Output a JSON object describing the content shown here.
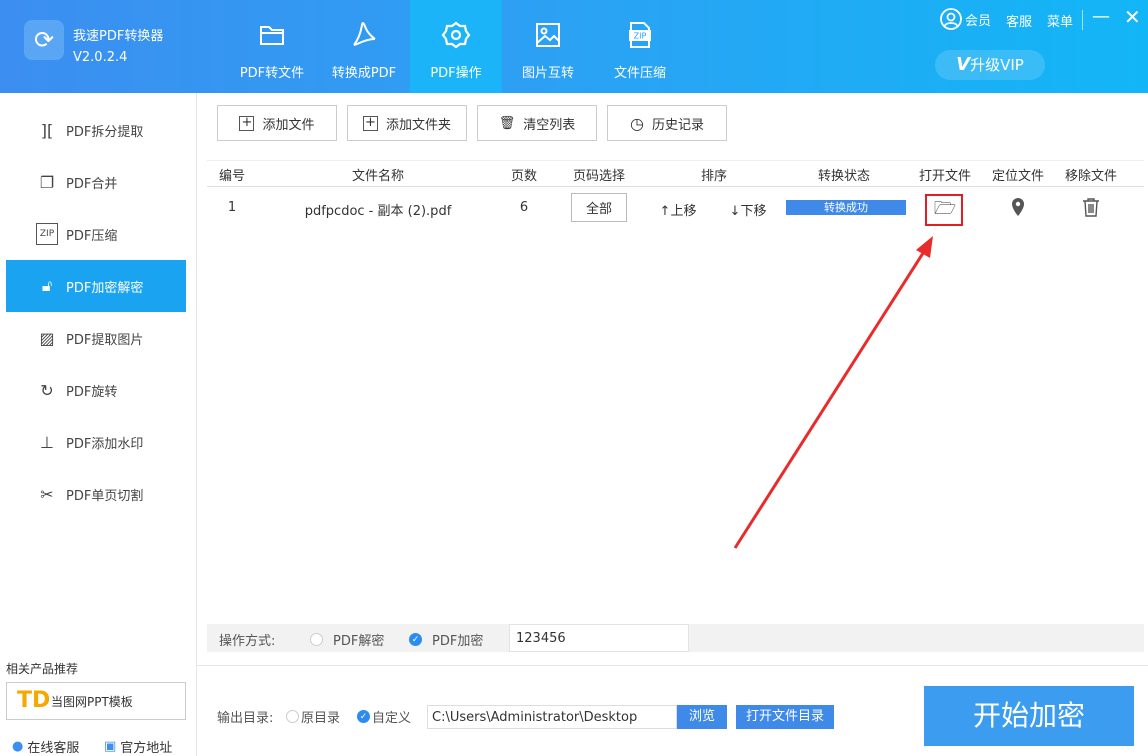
{
  "app": {
    "name": "我速PDF转换器",
    "version": "V2.0.2.4"
  },
  "tabs": [
    {
      "label": "PDF转文件",
      "icon": "folder-icon"
    },
    {
      "label": "转换成PDF",
      "icon": "acrobat-icon"
    },
    {
      "label": "PDF操作",
      "icon": "gear-icon",
      "active": true
    },
    {
      "label": "图片互转",
      "icon": "image-icon"
    },
    {
      "label": "文件压缩",
      "icon": "zip-icon"
    }
  ],
  "topright": {
    "member": "会员",
    "service": "客服",
    "menu": "菜单",
    "vip": "升级VIP"
  },
  "sidebar": {
    "items": [
      {
        "label": "PDF拆分提取",
        "icon": "split-icon"
      },
      {
        "label": "PDF合并",
        "icon": "merge-icon"
      },
      {
        "label": "PDF压缩",
        "icon": "zip-icon"
      },
      {
        "label": "PDF加密解密",
        "icon": "lock-icon",
        "active": true
      },
      {
        "label": "PDF提取图片",
        "icon": "image-icon"
      },
      {
        "label": "PDF旋转",
        "icon": "rotate-icon"
      },
      {
        "label": "PDF添加水印",
        "icon": "stamp-icon"
      },
      {
        "label": "PDF单页切割",
        "icon": "scissors-icon"
      }
    ],
    "related_title": "相关产品推荐",
    "related_product": "当图网PPT模板",
    "online_service": "在线客服",
    "official_site": "官方地址"
  },
  "toolbar": {
    "add_file": "添加文件",
    "add_folder": "添加文件夹",
    "clear": "清空列表",
    "history": "历史记录"
  },
  "table": {
    "headers": [
      "编号",
      "文件名称",
      "页数",
      "页码选择",
      "排序",
      "转换状态",
      "打开文件",
      "定位文件",
      "移除文件"
    ],
    "rows": [
      {
        "no": "1",
        "name": "pdfpcdoc - 副本 (2).pdf",
        "pages": "6",
        "range": "全部",
        "up": "↑上移",
        "down": "↓下移",
        "status": "转换成功"
      }
    ]
  },
  "operation": {
    "label": "操作方式:",
    "decrypt": "PDF解密",
    "encrypt": "PDF加密",
    "password": "123456"
  },
  "output": {
    "label": "输出目录:",
    "original": "原目录",
    "custom": "自定义",
    "path": "C:\\Users\\Administrator\\Desktop",
    "browse": "浏览",
    "open_dir": "打开文件目录"
  },
  "start": "开始加密",
  "colors": {
    "accent": "#1aa3f0",
    "button": "#3f8ae8",
    "annotation": "#e02020"
  }
}
